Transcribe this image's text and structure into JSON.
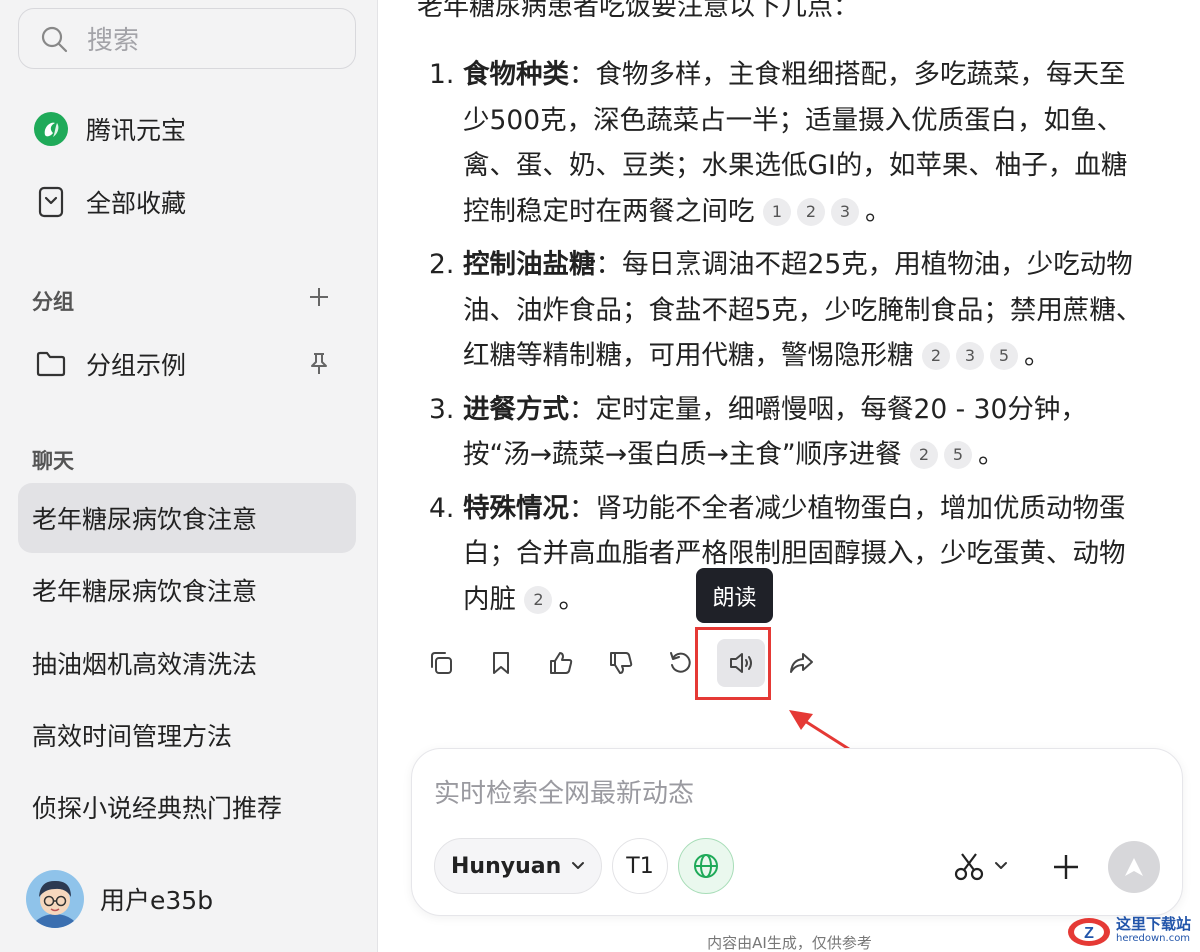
{
  "sidebar": {
    "search_placeholder": "搜索",
    "nav": [
      {
        "label": "腾讯元宝",
        "icon": "yuanbao-logo-icon"
      },
      {
        "label": "全部收藏",
        "icon": "bookmark-icon"
      }
    ],
    "groups_title": "分组",
    "group_items": [
      {
        "label": "分组示例",
        "icon": "folder-icon"
      }
    ],
    "chats_title": "聊天",
    "chats": [
      {
        "label": "老年糖尿病饮食注意",
        "active": true
      },
      {
        "label": "老年糖尿病饮食注意",
        "active": false
      },
      {
        "label": "抽油烟机高效清洗法",
        "active": false
      },
      {
        "label": "高效时间管理方法",
        "active": false
      },
      {
        "label": "侦探小说经典热门推荐",
        "active": false
      }
    ],
    "user_name": "用户e35b"
  },
  "answer": {
    "intro": "老年糖尿病患者吃饭要注意以下几点：",
    "points": [
      {
        "num": "1.",
        "title": "食物种类",
        "text": "：食物多样，主食粗细搭配，多吃蔬菜，每天至少500克，深色蔬菜占一半；适量摄入优质蛋白，如鱼、禽、蛋、奶、豆类；水果选低GI的，如苹果、柚子，血糖控制稳定时在两餐之间吃",
        "cites": [
          "1",
          "2",
          "3"
        ],
        "end": "。"
      },
      {
        "num": "2.",
        "title": "控制油盐糖",
        "text": "：每日烹调油不超25克，用植物油，少吃动物油、油炸食品；食盐不超5克，少吃腌制食品；禁用蔗糖、红糖等精制糖，可用代糖，警惕隐形糖",
        "cites": [
          "2",
          "3",
          "5"
        ],
        "end": "。"
      },
      {
        "num": "3.",
        "title": "进餐方式",
        "text": "：定时定量，细嚼慢咽，每餐20 - 30分钟，按“汤→蔬菜→蛋白质→主食”顺序进餐",
        "cites": [
          "2",
          "5"
        ],
        "end": "。"
      },
      {
        "num": "4.",
        "title": "特殊情况",
        "text": "：肾功能不全者减少植物蛋白，增加优质动物蛋白；合并高血脂者严格限制胆固醇摄入，少吃蛋黄、动物内脏",
        "cites": [
          "2"
        ],
        "end": "。"
      }
    ]
  },
  "toolbar": {
    "tooltip": "朗读",
    "buttons": [
      "copy-icon",
      "bookmark-icon",
      "thumbs-up-icon",
      "thumbs-down-icon",
      "regenerate-icon",
      "speaker-icon",
      "share-icon"
    ]
  },
  "input": {
    "placeholder": "实时检索全网最新动态",
    "model": "Hunyuan",
    "t1": "T1"
  },
  "footnote": "内容由AI生成，仅供参考",
  "watermark": {
    "site_name": "这里下载站",
    "site_url": "heredown.com"
  },
  "colors": {
    "accent_green": "#1faa59",
    "highlight_red": "#e53935",
    "sidebar_bg": "#f3f3f4"
  }
}
